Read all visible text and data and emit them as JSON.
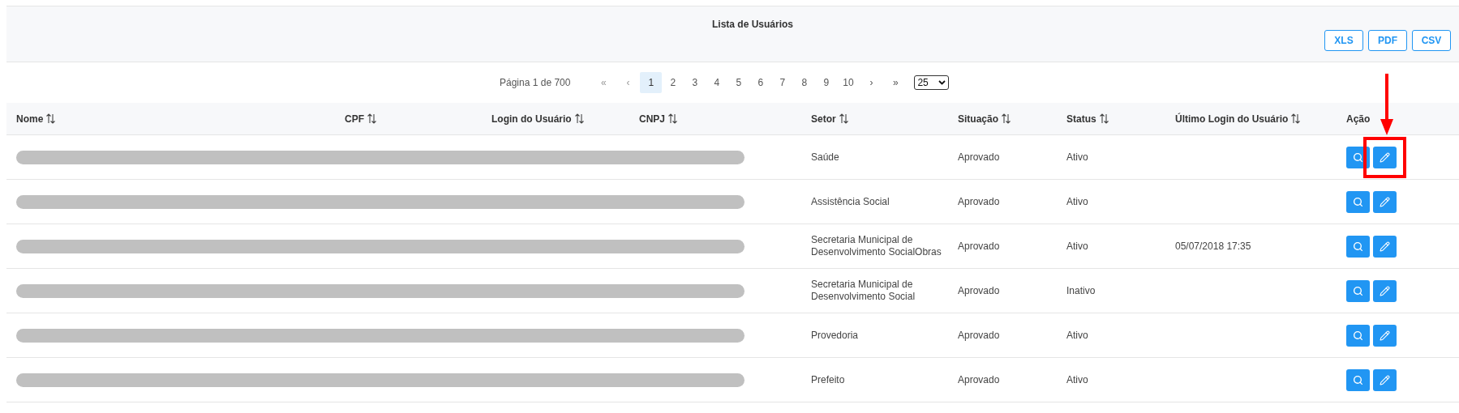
{
  "title": "Lista de Usuários",
  "export_buttons": [
    "XLS",
    "PDF",
    "CSV"
  ],
  "pagination": {
    "info": "Página 1 de 700",
    "first": "«",
    "prev": "‹",
    "next": "›",
    "last": "»",
    "pages": [
      {
        "label": "1",
        "selected": true
      },
      {
        "label": "2",
        "selected": false
      },
      {
        "label": "3",
        "selected": false
      },
      {
        "label": "4",
        "selected": false
      },
      {
        "label": "5",
        "selected": false
      },
      {
        "label": "6",
        "selected": false
      },
      {
        "label": "7",
        "selected": false
      },
      {
        "label": "8",
        "selected": false
      },
      {
        "label": "9",
        "selected": false
      },
      {
        "label": "10",
        "selected": false
      }
    ],
    "per_page": "25"
  },
  "table": {
    "columns": [
      {
        "label": "Nome",
        "sortable": true
      },
      {
        "label": "CPF",
        "sortable": true
      },
      {
        "label": "Login do Usuário",
        "sortable": true
      },
      {
        "label": "CNPJ",
        "sortable": true
      },
      {
        "label": "Setor",
        "sortable": true
      },
      {
        "label": "Situação",
        "sortable": true
      },
      {
        "label": "Status",
        "sortable": true
      },
      {
        "label": "Último Login do Usuário",
        "sortable": true
      },
      {
        "label": "Ação",
        "sortable": false
      }
    ],
    "rows": [
      {
        "redacted": true,
        "setor": "Saúde",
        "situacao": "Aprovado",
        "status": "Ativo",
        "ultimo_login": "",
        "highlighted": true
      },
      {
        "redacted": true,
        "setor": "Assistência Social",
        "situacao": "Aprovado",
        "status": "Ativo",
        "ultimo_login": "",
        "highlighted": false
      },
      {
        "redacted": true,
        "setor": "Secretaria Municipal de Desenvolvimento SocialObras",
        "situacao": "Aprovado",
        "status": "Ativo",
        "ultimo_login": "05/07/2018 17:35",
        "highlighted": false
      },
      {
        "redacted": true,
        "setor": "Secretaria Municipal de Desenvolvimento Social",
        "situacao": "Aprovado",
        "status": "Inativo",
        "ultimo_login": "",
        "highlighted": false
      },
      {
        "redacted": true,
        "setor": "Provedoria",
        "situacao": "Aprovado",
        "status": "Ativo",
        "ultimo_login": "",
        "highlighted": false
      },
      {
        "redacted": true,
        "setor": "Prefeito",
        "situacao": "Aprovado",
        "status": "Ativo",
        "ultimo_login": "",
        "highlighted": false
      }
    ]
  }
}
